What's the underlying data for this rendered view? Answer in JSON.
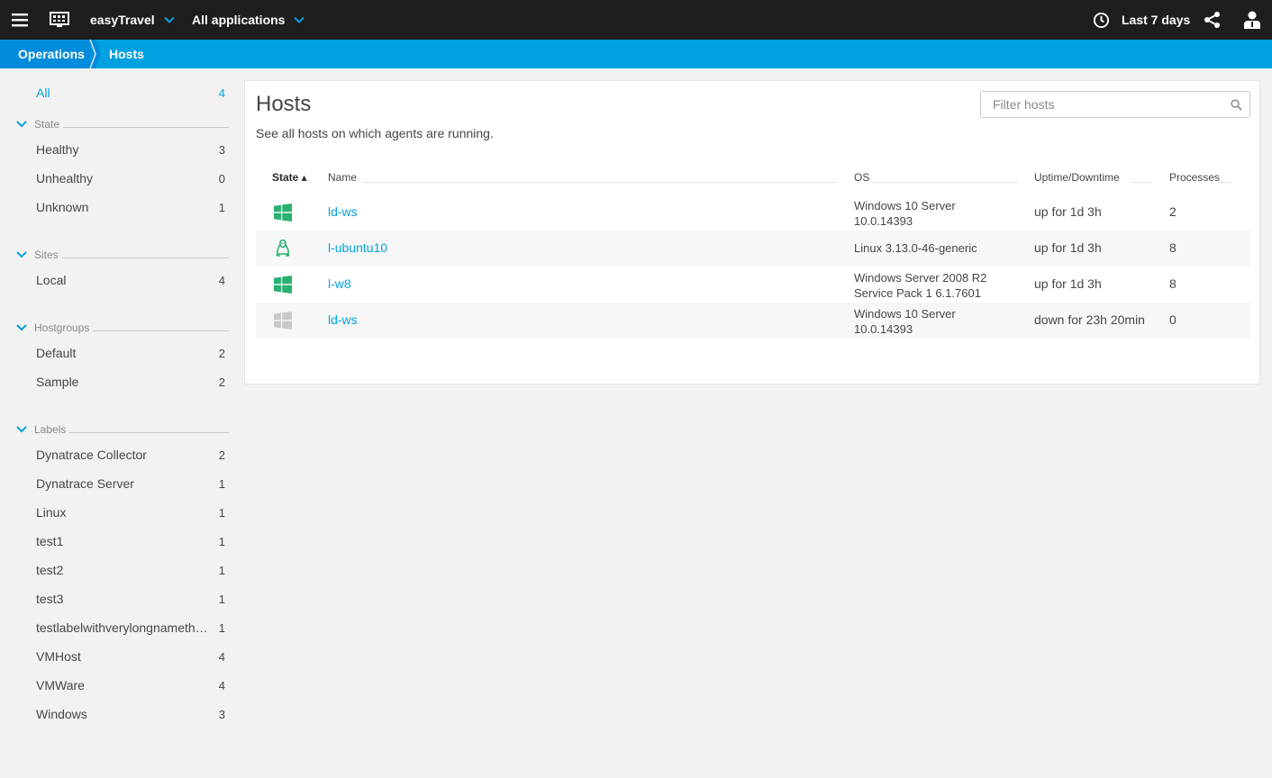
{
  "topbar": {
    "environment": "easyTravel",
    "app_filter": "All applications",
    "timeframe": "Last 7 days"
  },
  "breadcrumb": [
    "Operations",
    "Hosts"
  ],
  "sidebar": {
    "all": {
      "label": "All",
      "count": "4"
    },
    "groups": [
      {
        "title": "State",
        "items": [
          {
            "label": "Healthy",
            "count": "3"
          },
          {
            "label": "Unhealthy",
            "count": "0"
          },
          {
            "label": "Unknown",
            "count": "1"
          }
        ]
      },
      {
        "title": "Sites",
        "items": [
          {
            "label": "Local",
            "count": "4"
          }
        ]
      },
      {
        "title": "Hostgroups",
        "items": [
          {
            "label": "Default",
            "count": "2"
          },
          {
            "label": "Sample",
            "count": "2"
          }
        ]
      },
      {
        "title": "Labels",
        "items": [
          {
            "label": "Dynatrace Collector",
            "count": "2"
          },
          {
            "label": "Dynatrace Server",
            "count": "1"
          },
          {
            "label": "Linux",
            "count": "1"
          },
          {
            "label": "test1",
            "count": "1"
          },
          {
            "label": "test2",
            "count": "1"
          },
          {
            "label": "test3",
            "count": "1"
          },
          {
            "label": "testlabelwithverylongnameth…",
            "count": "1"
          },
          {
            "label": "VMHost",
            "count": "4"
          },
          {
            "label": "VMWare",
            "count": "4"
          },
          {
            "label": "Windows",
            "count": "3"
          }
        ]
      }
    ]
  },
  "main": {
    "title": "Hosts",
    "description": "See all hosts on which agents are running.",
    "filter_placeholder": "Filter hosts",
    "columns": {
      "state": "State ▴",
      "name": "Name",
      "os": "OS",
      "uptime": "Uptime/Downtime",
      "processes": "Processes"
    },
    "rows": [
      {
        "icon": "windows-icon",
        "state": "healthy",
        "name": "ld-ws",
        "os1": "Windows 10 Server",
        "os2": "10.0.14393",
        "uptime": "up for 1d 3h",
        "processes": "2"
      },
      {
        "icon": "linux-icon",
        "state": "healthy",
        "name": "l-ubuntu10",
        "os1": "Linux 3.13.0-46-generic",
        "os2": "",
        "uptime": "up for 1d 3h",
        "processes": "8"
      },
      {
        "icon": "windows-icon",
        "state": "healthy",
        "name": "l-w8",
        "os1": "Windows Server 2008 R2",
        "os2": "Service Pack 1 6.1.7601",
        "uptime": "up for 1d 3h",
        "processes": "8"
      },
      {
        "icon": "windows-icon",
        "state": "unknown",
        "name": "ld-ws",
        "os1": "Windows 10 Server",
        "os2": "10.0.14393",
        "uptime": "down for 23h 20min",
        "processes": "0"
      }
    ]
  },
  "colors": {
    "topbar": "#1e1e1e",
    "breadcrumb": "#00a1e0",
    "accent": "#00a1e0",
    "healthy": "#2ab06f",
    "unknown": "#c8c8c8"
  }
}
